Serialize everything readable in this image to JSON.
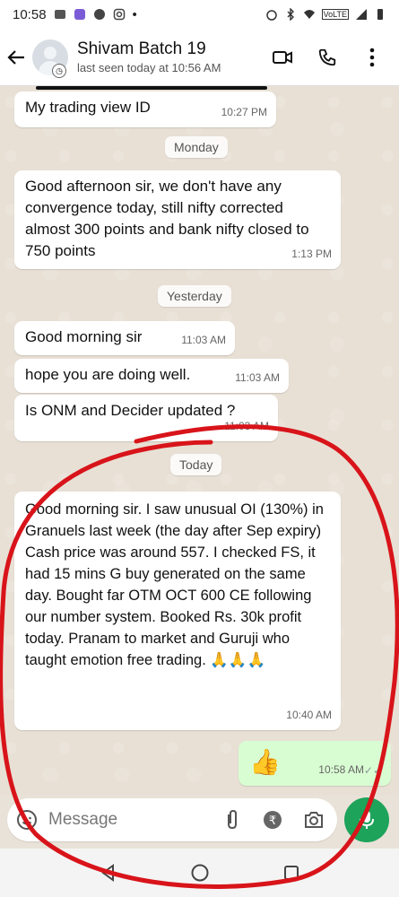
{
  "status_bar": {
    "time": "10:58",
    "network": "VoLTE"
  },
  "header": {
    "chat_name": "Shivam Batch 19",
    "last_seen": "last seen today at 10:56 AM"
  },
  "messages": [
    {
      "text": "My trading view ID",
      "time": "10:27 PM"
    },
    {
      "date": "Monday"
    },
    {
      "text": "Good afternoon sir, we don't have any convergence today, still nifty corrected almost 300 points and bank nifty closed to 750 points",
      "time": "1:13 PM"
    },
    {
      "date": "Yesterday"
    },
    {
      "text": "Good morning sir",
      "time": "11:03 AM"
    },
    {
      "text": "hope you are doing well.",
      "time": "11:03 AM"
    },
    {
      "text": "Is ONM and Decider updated ?",
      "time": "11:03 AM"
    },
    {
      "date": "Today"
    },
    {
      "text": "Good morning sir. I saw unusual OI (130%) in Granuels last week (the day after Sep expiry) Cash price was around 557. I checked FS, it had 15 mins G buy generated on the same day.  Bought far OTM OCT 600 CE following our number system. Booked Rs. 30k profit today. Pranam to market and Guruji who taught  emotion free trading. 🙏🙏🙏",
      "time": "10:40 AM"
    },
    {
      "text": "👍",
      "time": "10:58 AM",
      "outgoing": true
    }
  ],
  "input": {
    "placeholder": "Message"
  },
  "colors": {
    "annotation": "#d8141a",
    "mic": "#1da35a",
    "outgoing_bubble": "#d9fdd3"
  },
  "icons": [
    "back-arrow-icon",
    "video-call-icon",
    "phone-icon",
    "more-vert-icon",
    "emoji-icon",
    "attach-icon",
    "rupee-icon",
    "camera-icon",
    "mic-icon"
  ]
}
